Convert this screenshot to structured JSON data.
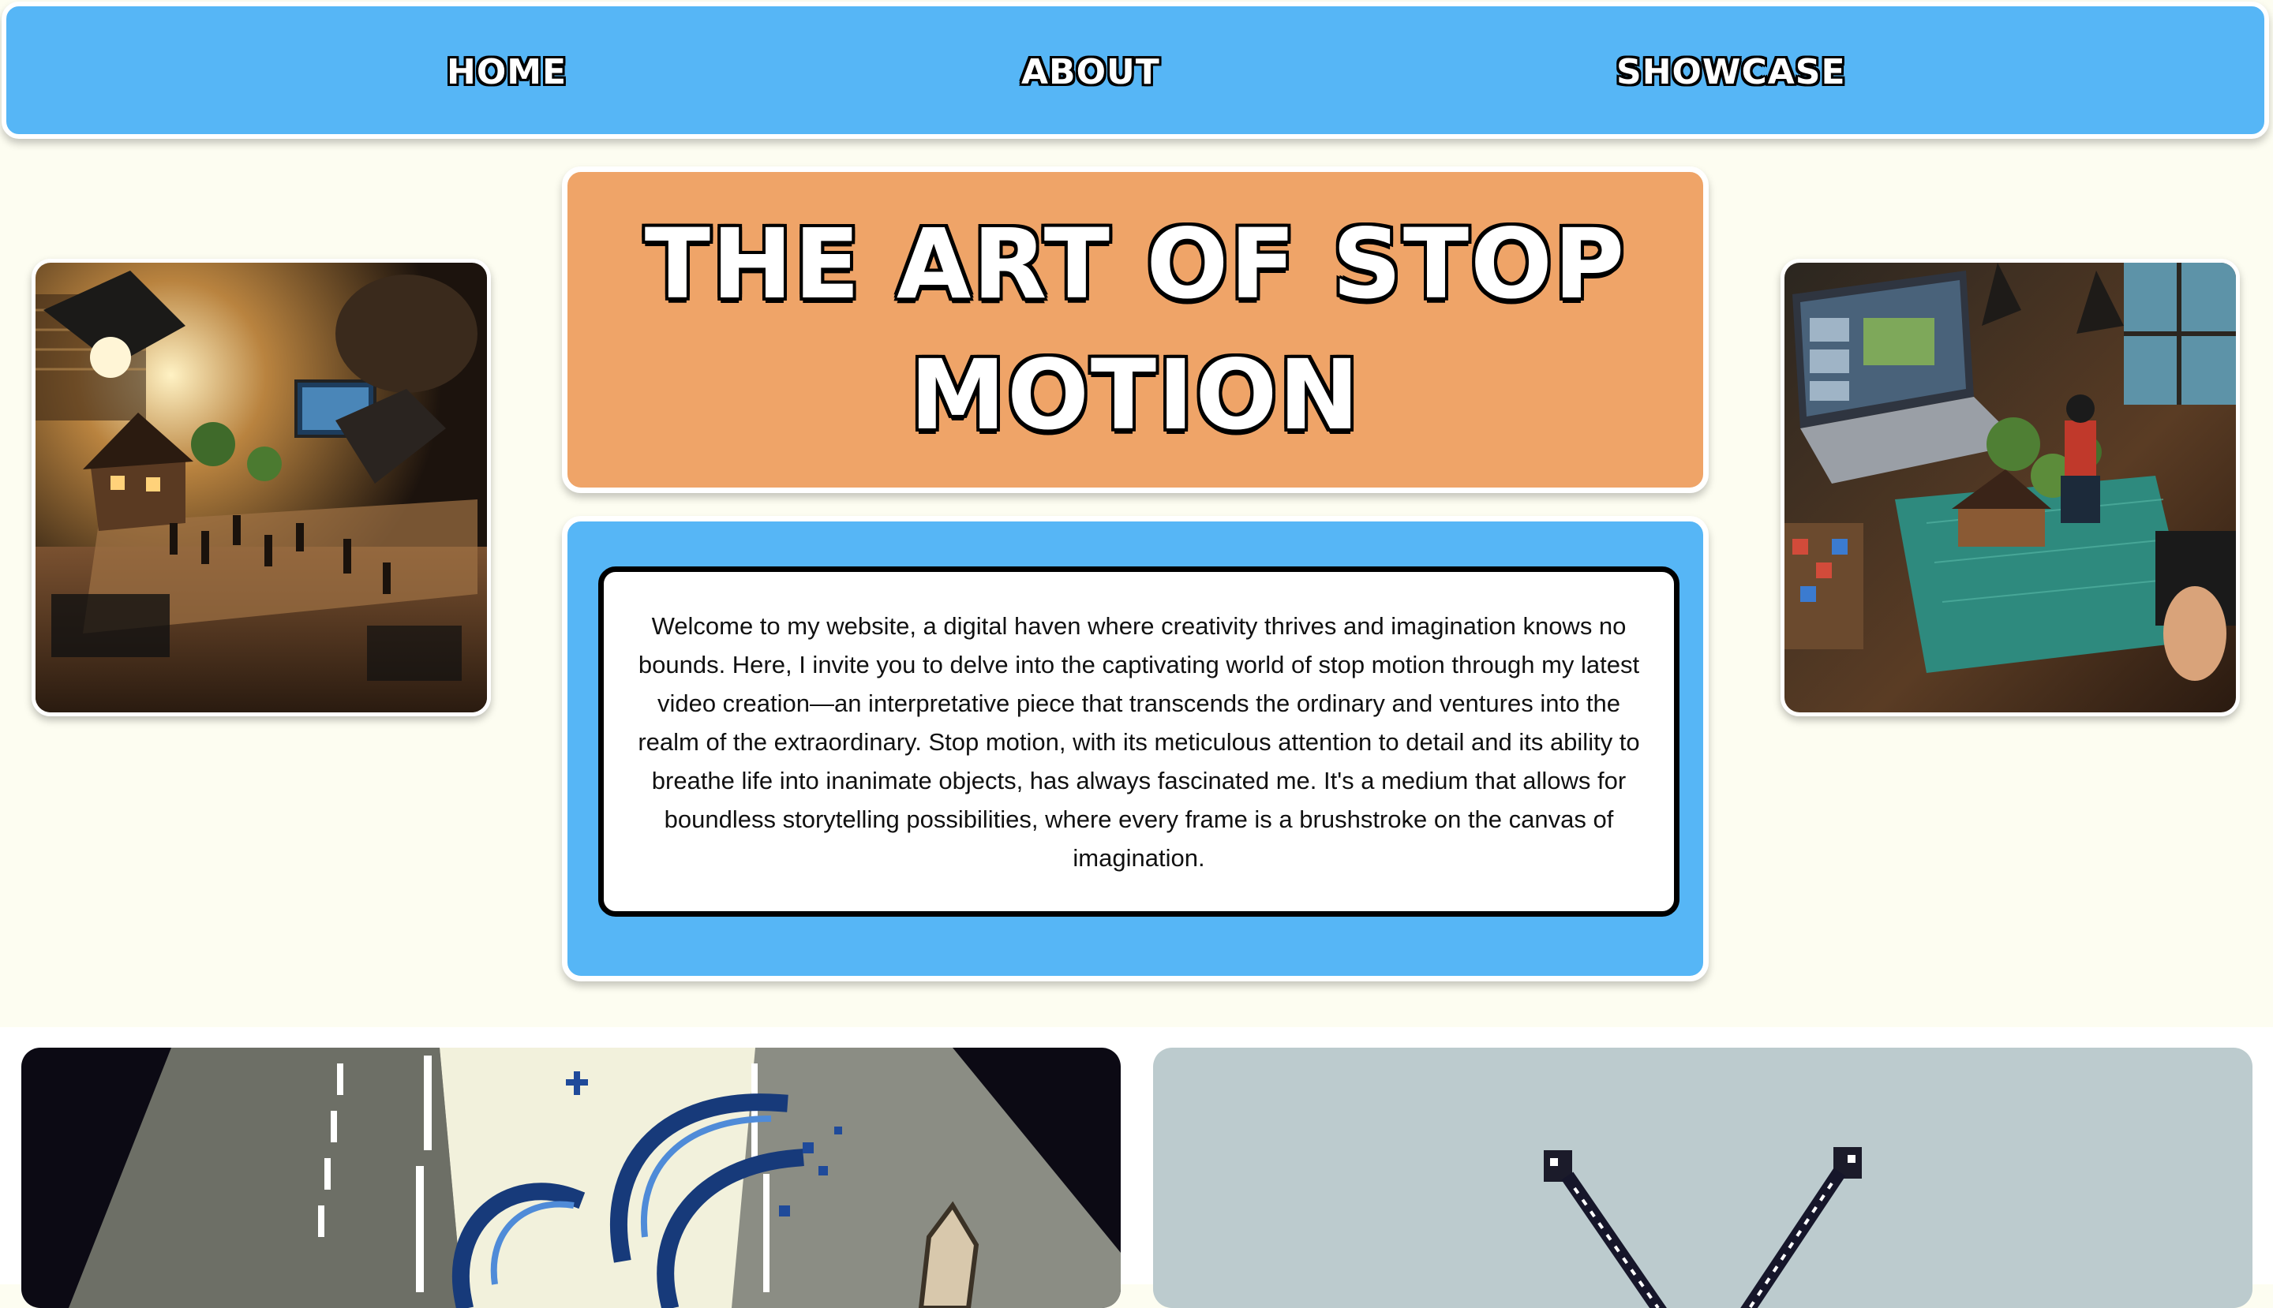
{
  "nav": {
    "items": [
      {
        "label": "HOME"
      },
      {
        "label": "ABOUT"
      },
      {
        "label": "SHOWCASE"
      }
    ]
  },
  "hero": {
    "title": "THE ART OF STOP MOTION"
  },
  "intro": {
    "text": "Welcome to my website, a digital haven where creativity thrives and imagination knows no bounds. Here, I invite you to delve into the captivating world of stop motion through my latest video creation—an interpretative piece that transcends the ordinary and ventures into the realm of the extraordinary. Stop motion, with its meticulous attention to detail and its ability to breathe life into inanimate objects, has always fascinated me. It's a medium that allows for boundless storytelling possibilities, where every frame is a brushstroke on the canvas of imagination."
  },
  "colors": {
    "page_background": "#fdfdf1",
    "nav_background": "#56b6f6",
    "title_background": "#efa468",
    "intro_background": "#56b6f6",
    "card_background": "#ffffff"
  },
  "images": {
    "left_image": "stop-motion-studio-photo",
    "right_image": "stop-motion-desk-laptop-photo",
    "gallery_left": "pixel-art-wave-thumbnail",
    "gallery_right": "pixel-art-crossed-tools-thumbnail"
  }
}
